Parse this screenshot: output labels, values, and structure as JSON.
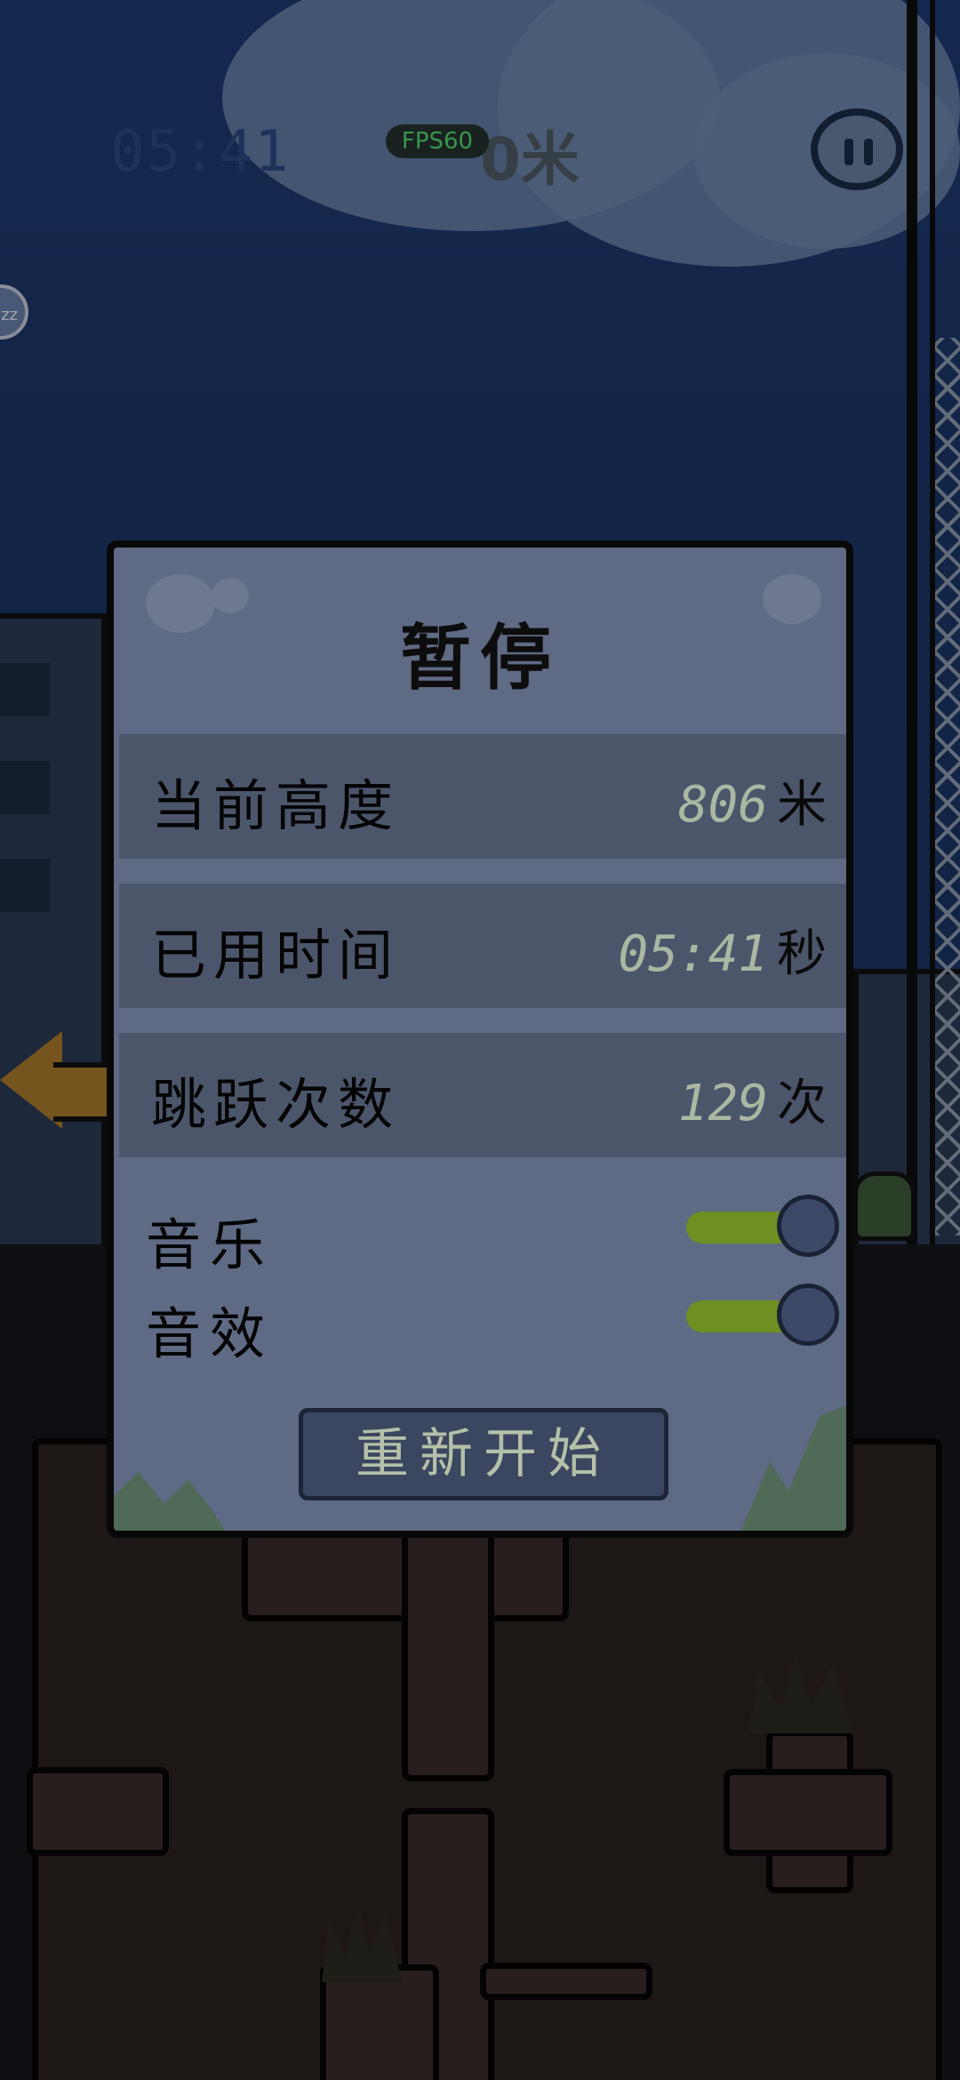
{
  "hud": {
    "timer": "05:41",
    "fps": "FPS60",
    "height_partial": "0米",
    "side_bubble": "zz"
  },
  "pause_dialog": {
    "title": "暂停",
    "stats": [
      {
        "label": "当前高度",
        "value": "806",
        "unit": "米"
      },
      {
        "label": "已用时间",
        "value": "05:41",
        "unit": "秒"
      },
      {
        "label": "跳跃次数",
        "value": "129",
        "unit": "次"
      }
    ],
    "settings": [
      {
        "label": "音乐",
        "on": true
      },
      {
        "label": "音效",
        "on": true
      }
    ],
    "restart_label": "重新开始"
  },
  "colors": {
    "toggle_on": "#6f8f22",
    "fps_text": "#4fe067",
    "dialog_bg": "#5f6a84"
  }
}
